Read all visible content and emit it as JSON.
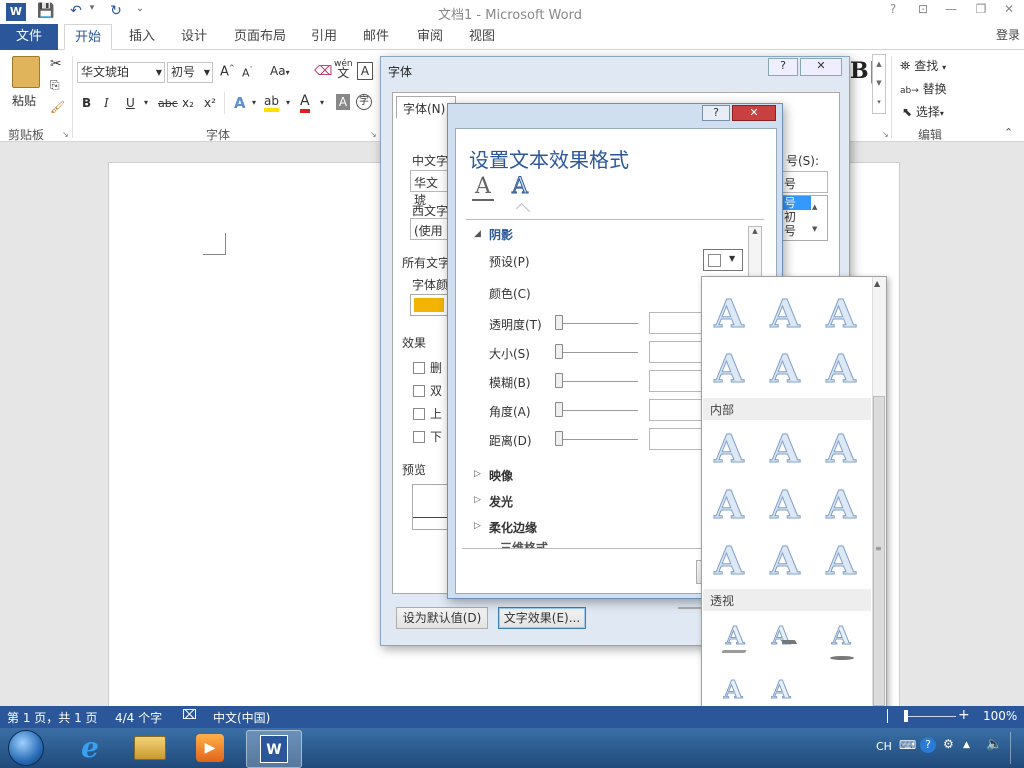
{
  "window": {
    "title": "文档1 - Microsoft Word",
    "login": "登录",
    "help": "?",
    "min": "—",
    "restore": "❐",
    "close": "✕"
  },
  "tabs": [
    "文件",
    "开始",
    "插入",
    "设计",
    "页面布局",
    "引用",
    "邮件",
    "审阅",
    "视图"
  ],
  "ribbon": {
    "paste": "粘贴",
    "clipboard_group": "剪贴板",
    "font_name": "华文琥珀",
    "font_size": "初号",
    "font_group": "字体",
    "find": "查找",
    "replace": "替换",
    "select": "选择",
    "edit_group": "编辑",
    "bold": "B",
    "italic": "I",
    "underline": "U",
    "strike": "abc",
    "sub": "x₂",
    "sup": "x²",
    "grow": "A^",
    "shrink": "Aˇ",
    "case": "Aa",
    "phonetic": "wén\n文",
    "border_char": "A"
  },
  "font_dialog": {
    "title": "字体",
    "tab_font": "字体(N)",
    "cn_font_label": "中文字",
    "cn_font_value": "华文琥",
    "west_font_label": "西文字",
    "west_font_value": "(使用",
    "all_text": "所有文字",
    "font_color": "字体颜",
    "effects": "效果",
    "effect_items": [
      "删",
      "双",
      "上",
      "下"
    ],
    "preview": "预览",
    "size_label": "号(S):",
    "size_value": "号",
    "size_list": [
      "号",
      "初",
      "号"
    ],
    "set_default": "设为默认值(D)",
    "text_effects": "文字效果(E)..."
  },
  "effects_dialog": {
    "title": "设置文本效果格式",
    "sections": {
      "shadow": "阴影",
      "reflection": "映像",
      "glow": "发光",
      "soft_edges": "柔化边缘",
      "three_d": "三维格式"
    },
    "props": {
      "preset": "预设(P)",
      "color": "颜色(C)",
      "transparency": "透明度(T)",
      "size": "大小(S)",
      "blur": "模糊(B)",
      "angle": "角度(A)",
      "distance": "距离(D)"
    }
  },
  "preset_gallery": {
    "inner_label": "内部",
    "perspective_label": "透视"
  },
  "status": {
    "page": "第 1 页，共 1 页",
    "words": "4/4 个字",
    "lang": "中文(中国)",
    "zoom": "100%"
  },
  "taskbar": {
    "ime": "CH"
  }
}
